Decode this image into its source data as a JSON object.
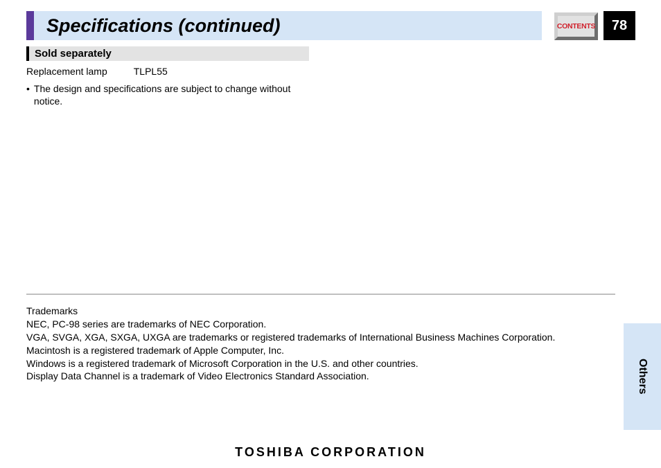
{
  "header": {
    "title": "Specifications (continued)",
    "contents_label": "CONTENTS",
    "page_number": "78"
  },
  "section": {
    "heading": "Sold separately",
    "item_label": "Replacement lamp",
    "item_value": "TLPL55"
  },
  "note": {
    "bullet": "•",
    "text": "The design and specifications are subject to change without notice."
  },
  "trademarks": {
    "heading": "Trademarks",
    "line1": "NEC, PC-98 series are trademarks of NEC Corporation.",
    "line2": "VGA, SVGA, XGA, SXGA, UXGA are trademarks or registered trademarks of International Business Machines Corporation.",
    "line3": "Macintosh is a registered trademark of Apple Computer, Inc.",
    "line4": "Windows is a registered trademark of Microsoft Corporation in the U.S. and other countries.",
    "line5": "Display Data Channel is a trademark of Video Electronics Standard Association."
  },
  "side_tab": {
    "label": "Others"
  },
  "footer": {
    "brand": "TOSHIBA CORPORATION"
  }
}
